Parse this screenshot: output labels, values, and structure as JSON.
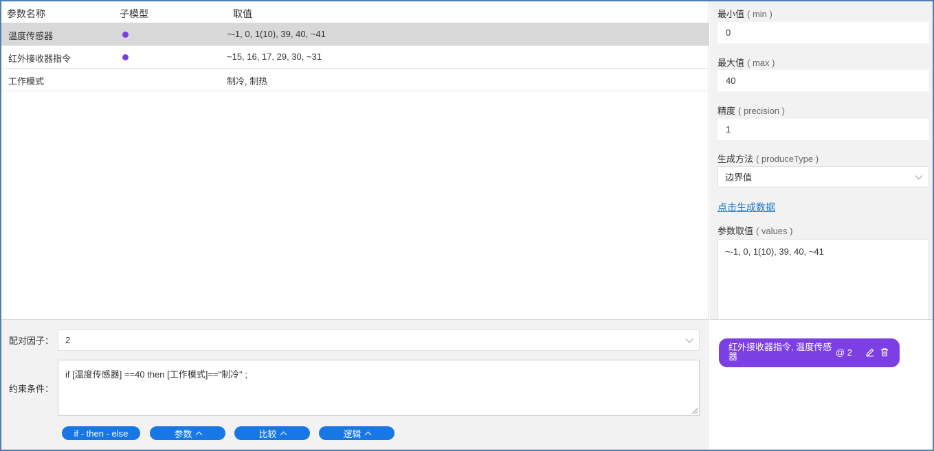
{
  "table": {
    "headers": [
      "参数名称",
      "子模型",
      "取值"
    ],
    "rows": [
      {
        "name": "温度传感器",
        "has_submodel": true,
        "values": "~-1, 0, 1(10), 39, 40, ~41"
      },
      {
        "name": "红外接收器指令",
        "has_submodel": true,
        "values": "~15, 16, 17, 29, 30, ~31"
      },
      {
        "name": "工作模式",
        "has_submodel": false,
        "values": "制冷, 制热"
      }
    ],
    "selected_row": 0,
    "submodel_dot_color": "#7b3fe4"
  },
  "right_panel": {
    "min": {
      "label": "最小值",
      "hint": "( min )",
      "value": "0"
    },
    "max": {
      "label": "最大值",
      "hint": "( max )",
      "value": "40"
    },
    "precision": {
      "label": "精度",
      "hint": "( precision )",
      "value": "1"
    },
    "produce_type": {
      "label": "生成方法",
      "hint": "( produceType )",
      "value": "边界值"
    },
    "generate_link": "点击生成数据",
    "values": {
      "label": "参数取值",
      "hint": "( values )",
      "value": "~-1, 0, 1(10), 39, 40, ~41"
    }
  },
  "constraint": {
    "pair_factor_label": "配对因子：",
    "pair_factor_value": "2",
    "condition_label": "约束条件：",
    "condition_value": "if [温度传感器] ==40  then [工作模式]==\"制冷\" ;",
    "buttons": [
      {
        "label": "if - then - else",
        "caret": false
      },
      {
        "label": "参数",
        "caret": true
      },
      {
        "label": "比较",
        "caret": true
      },
      {
        "label": "逻辑",
        "caret": true
      }
    ],
    "button_color": "#1677e5"
  },
  "chip": {
    "text": "红外接收器指令, 温度传感器",
    "count": "@ 2",
    "icons": [
      "edit-icon",
      "delete-icon"
    ],
    "color": "#7b3fe4"
  }
}
